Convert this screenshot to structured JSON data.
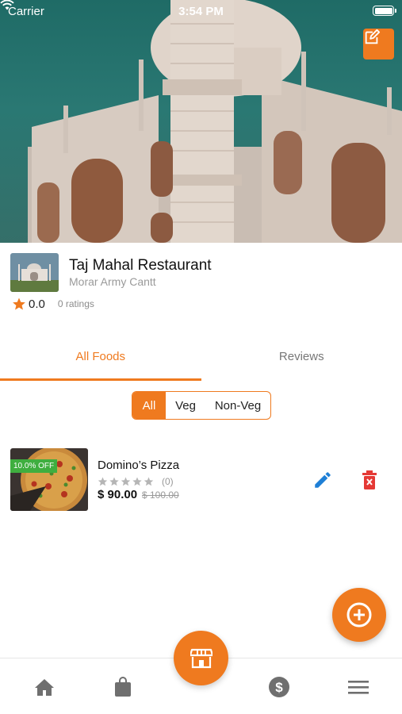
{
  "status_bar": {
    "carrier": "Carrier",
    "time": "3:54 PM"
  },
  "restaurant": {
    "name": "Taj Mahal Restaurant",
    "address": "Morar Army Cantt",
    "rating": "0.0",
    "ratings_count": "0 ratings"
  },
  "tabs": [
    {
      "label": "All Foods",
      "active": true
    },
    {
      "label": "Reviews",
      "active": false
    }
  ],
  "filter": {
    "options": [
      "All",
      "Veg",
      "Non-Veg"
    ],
    "selected": "All"
  },
  "foods": [
    {
      "name": "Domino’s Pizza",
      "discount": "10.0% OFF",
      "reviews": "(0)",
      "price": "$ 90.00",
      "original_price": "$ 100.00",
      "stars": 0
    }
  ],
  "colors": {
    "accent": "#ef7a1f",
    "discount": "#3fae3f",
    "edit": "#1e7fd6",
    "delete": "#e53935"
  },
  "icons": {
    "edit_restaurant": "edit-square-icon",
    "add": "add-circle-icon",
    "nav": [
      "home-icon",
      "bag-icon",
      "store-icon",
      "dollar-icon",
      "menu-icon"
    ]
  }
}
